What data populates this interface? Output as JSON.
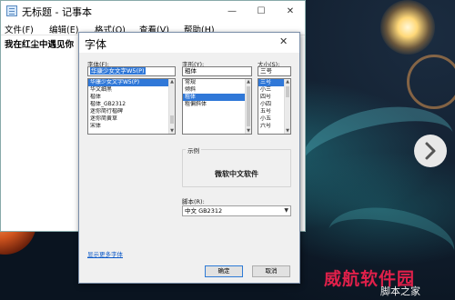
{
  "notepad": {
    "title": "无标题 - 记事本",
    "window_controls": {
      "minimize": "—",
      "maximize": "☐",
      "close": "✕"
    },
    "menus": [
      "文件(F)",
      "编辑(E)",
      "格式(O)",
      "查看(V)",
      "帮助(H)"
    ],
    "content_text": "我在红尘中遇见你"
  },
  "font_dialog": {
    "title": "字体",
    "close": "✕",
    "font": {
      "label": "字体(F):",
      "value": "华康少女文字W5(P)",
      "items": [
        "华康少女文字W5(P)",
        "华文细黑",
        "楷体",
        "楷体_GB2312",
        "迷你简行楷碑",
        "迷你简黄草",
        "宋体"
      ]
    },
    "style": {
      "label": "字形(Y):",
      "value": "粗体",
      "items": [
        "常规",
        "倾斜",
        "粗体",
        "粗偏斜体"
      ],
      "selected_index": 2
    },
    "size": {
      "label": "大小(S):",
      "value": "三号",
      "items": [
        "三号",
        "小三",
        "四号",
        "小四",
        "五号",
        "小五",
        "六号"
      ],
      "selected_index": 0
    },
    "sample": {
      "label": "示例",
      "text": "微软中文软件"
    },
    "script": {
      "label": "脚本(R):",
      "value": "中文 GB2312"
    },
    "more_fonts_link": "显示更多字体",
    "ok_label": "确定",
    "cancel_label": "取消"
  },
  "watermark": {
    "logo_text": "威航软件园",
    "sub_text": "脚本之家"
  },
  "icons": {
    "next": "chevron-right-icon"
  }
}
